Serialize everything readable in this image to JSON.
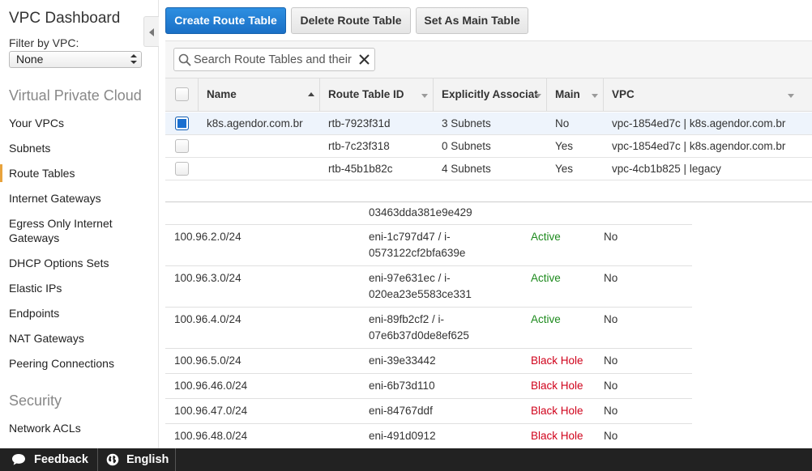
{
  "sidebar": {
    "title": "VPC Dashboard",
    "filter_label": "Filter by VPC:",
    "filter_value": "None",
    "section_vpc": "Virtual Private Cloud",
    "items": [
      {
        "label": "Your VPCs"
      },
      {
        "label": "Subnets"
      },
      {
        "label": "Route Tables"
      },
      {
        "label": "Internet Gateways"
      },
      {
        "label": "Egress Only Internet Gateways"
      },
      {
        "label": "DHCP Options Sets"
      },
      {
        "label": "Elastic IPs"
      },
      {
        "label": "Endpoints"
      },
      {
        "label": "NAT Gateways"
      },
      {
        "label": "Peering Connections"
      }
    ],
    "section_security": "Security",
    "security_items": [
      {
        "label": "Network ACLs"
      }
    ],
    "active_item": "Route Tables",
    "accent_color": "#e8a33d"
  },
  "toolbar": {
    "create_label": "Create Route Table",
    "delete_label": "Delete Route Table",
    "set_main_label": "Set As Main Table"
  },
  "search": {
    "placeholder": "Search Route Tables and their"
  },
  "route_tables": {
    "columns": [
      "Name",
      "Route Table ID",
      "Explicitly Associat",
      "Main",
      "VPC"
    ],
    "rows": [
      {
        "name": "k8s.agendor.com.br",
        "id": "rtb-7923f31d",
        "assoc": "3 Subnets",
        "main": "No",
        "vpc": "vpc-1854ed7c | k8s.agendor.com.br",
        "selected": true
      },
      {
        "name": "",
        "id": "rtb-7c23f318",
        "assoc": "0 Subnets",
        "main": "Yes",
        "vpc": "vpc-1854ed7c | k8s.agendor.com.br",
        "selected": false
      },
      {
        "name": "",
        "id": "rtb-45b1b82c",
        "assoc": "4 Subnets",
        "main": "Yes",
        "vpc": "vpc-4cb1b825 | legacy",
        "selected": false
      }
    ]
  },
  "routes": {
    "partial_target": "03463dda381e9e429",
    "rows": [
      {
        "dest": "100.96.2.0/24",
        "target1": "eni-1c797d47 / i-",
        "target2": "0573122cf2bfa639e",
        "status": "Active",
        "propagated": "No"
      },
      {
        "dest": "100.96.3.0/24",
        "target1": "eni-97e631ec / i-",
        "target2": "020ea23e5583ce331",
        "status": "Active",
        "propagated": "No"
      },
      {
        "dest": "100.96.4.0/24",
        "target1": "eni-89fb2cf2 / i-",
        "target2": "07e6b37d0de8ef625",
        "status": "Active",
        "propagated": "No"
      },
      {
        "dest": "100.96.5.0/24",
        "target1": "eni-39e33442",
        "target2": "",
        "status": "Black Hole",
        "propagated": "No"
      },
      {
        "dest": "100.96.46.0/24",
        "target1": "eni-6b73d110",
        "target2": "",
        "status": "Black Hole",
        "propagated": "No"
      },
      {
        "dest": "100.96.47.0/24",
        "target1": "eni-84767ddf",
        "target2": "",
        "status": "Black Hole",
        "propagated": "No"
      },
      {
        "dest": "100.96.48.0/24",
        "target1": "eni-491d0912",
        "target2": "",
        "status": "Black Hole",
        "propagated": "No"
      }
    ],
    "colors": {
      "active": "#1d8a1d",
      "blackhole": "#d0021b"
    }
  },
  "footer": {
    "feedback_label": "Feedback",
    "language_label": "English"
  }
}
